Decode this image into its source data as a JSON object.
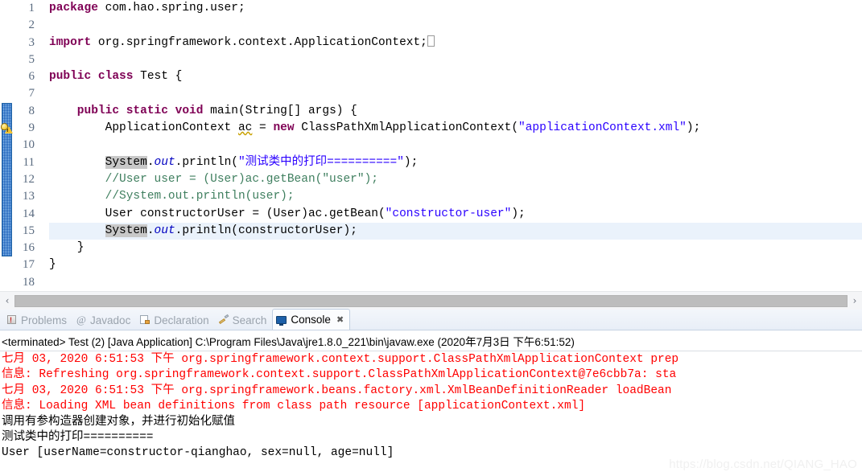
{
  "editor": {
    "lines": [
      {
        "num": "1",
        "fold": "",
        "highlight": false,
        "segments": [
          {
            "t": "package ",
            "c": "kw"
          },
          {
            "t": "com.hao.spring.user;",
            "c": "plain"
          }
        ]
      },
      {
        "num": "2",
        "fold": "",
        "highlight": false,
        "segments": []
      },
      {
        "num": "3",
        "fold": "plus",
        "highlight": false,
        "segments": [
          {
            "t": "import ",
            "c": "kw"
          },
          {
            "t": "org.springframework.context.ApplicationContext;",
            "c": "plain"
          },
          {
            "t": "​",
            "c": "caret"
          }
        ]
      },
      {
        "num": "5",
        "fold": "",
        "highlight": false,
        "segments": []
      },
      {
        "num": "6",
        "fold": "",
        "highlight": false,
        "segments": [
          {
            "t": "public class ",
            "c": "kw"
          },
          {
            "t": "Test {",
            "c": "plain"
          }
        ]
      },
      {
        "num": "7",
        "fold": "",
        "highlight": false,
        "segments": []
      },
      {
        "num": "8",
        "fold": "minus",
        "highlight": false,
        "segments": [
          {
            "t": "    public static void ",
            "c": "kw"
          },
          {
            "t": "main(String[] args) {",
            "c": "plain"
          }
        ]
      },
      {
        "num": "9",
        "fold": "",
        "highlight": false,
        "segments": [
          {
            "t": "        ApplicationContext ",
            "c": "plain"
          },
          {
            "t": "ac",
            "c": "squiggle"
          },
          {
            "t": " = ",
            "c": "plain"
          },
          {
            "t": "new ",
            "c": "kw"
          },
          {
            "t": "ClassPathXmlApplicationContext(",
            "c": "plain"
          },
          {
            "t": "\"applicationContext.xml\"",
            "c": "str"
          },
          {
            "t": ");",
            "c": "plain"
          }
        ]
      },
      {
        "num": "10",
        "fold": "",
        "highlight": false,
        "segments": []
      },
      {
        "num": "11",
        "fold": "",
        "highlight": false,
        "segments": [
          {
            "t": "        ",
            "c": "plain"
          },
          {
            "t": "System",
            "c": "sel"
          },
          {
            "t": ".",
            "c": "plain"
          },
          {
            "t": "out",
            "c": "fld"
          },
          {
            "t": ".println(",
            "c": "plain"
          },
          {
            "t": "\"测试类中的打印==========\"",
            "c": "str"
          },
          {
            "t": ");",
            "c": "plain"
          }
        ]
      },
      {
        "num": "12",
        "fold": "",
        "highlight": false,
        "segments": [
          {
            "t": "        //User user = (User)ac.getBean(\"user\");",
            "c": "cmt"
          }
        ]
      },
      {
        "num": "13",
        "fold": "",
        "highlight": false,
        "segments": [
          {
            "t": "        //System.out.println(user);",
            "c": "cmt"
          }
        ]
      },
      {
        "num": "14",
        "fold": "",
        "highlight": false,
        "segments": [
          {
            "t": "        User constructorUser = (User)ac.getBean(",
            "c": "plain"
          },
          {
            "t": "\"constructor-user\"",
            "c": "str"
          },
          {
            "t": ");",
            "c": "plain"
          }
        ]
      },
      {
        "num": "15",
        "fold": "",
        "highlight": true,
        "segments": [
          {
            "t": "        ",
            "c": "plain"
          },
          {
            "t": "System",
            "c": "sel"
          },
          {
            "t": ".",
            "c": "plain"
          },
          {
            "t": "out",
            "c": "fld"
          },
          {
            "t": ".println(constructorUser);",
            "c": "plain"
          }
        ]
      },
      {
        "num": "16",
        "fold": "",
        "highlight": false,
        "segments": [
          {
            "t": "    }",
            "c": "plain"
          }
        ]
      },
      {
        "num": "17",
        "fold": "",
        "highlight": false,
        "segments": [
          {
            "t": "}",
            "c": "plain"
          }
        ]
      },
      {
        "num": "18",
        "fold": "",
        "highlight": false,
        "segments": []
      }
    ],
    "scroll": {
      "left_arrow": "‹",
      "right_arrow": "›"
    }
  },
  "panel": {
    "tabs": [
      {
        "label": "Problems",
        "icon": "problems-icon",
        "active": false,
        "closable": false
      },
      {
        "label": "Javadoc",
        "icon": "javadoc-icon",
        "active": false,
        "closable": false
      },
      {
        "label": "Declaration",
        "icon": "declaration-icon",
        "active": false,
        "closable": false
      },
      {
        "label": "Search",
        "icon": "search-icon",
        "active": false,
        "closable": false
      },
      {
        "label": "Console",
        "icon": "console-icon",
        "active": true,
        "closable": true
      }
    ],
    "close_glyph": "✖",
    "console_header": "<terminated> Test (2) [Java Application] C:\\Program Files\\Java\\jre1.8.0_221\\bin\\javaw.exe (2020年7月3日 下午6:51:52)",
    "console_lines": [
      {
        "text": "七月 03, 2020 6:51:53 下午 org.springframework.context.support.ClassPathXmlApplicationContext prep",
        "color": "red"
      },
      {
        "text": "信息: Refreshing org.springframework.context.support.ClassPathXmlApplicationContext@7e6cbb7a: sta",
        "color": "red"
      },
      {
        "text": "七月 03, 2020 6:51:53 下午 org.springframework.beans.factory.xml.XmlBeanDefinitionReader loadBean",
        "color": "red"
      },
      {
        "text": "信息: Loading XML bean definitions from class path resource [applicationContext.xml]",
        "color": "red"
      },
      {
        "text": "调用有参构造器创建对象，并进行初始化赋值",
        "color": "black"
      },
      {
        "text": "测试类中的打印==========",
        "color": "black"
      },
      {
        "text": "User [userName=constructor-qianghao, sex=null, age=null]",
        "color": "black"
      }
    ]
  },
  "watermark": {
    "text": "https://blog.csdn.net/QIANG_HAO"
  },
  "colors": {
    "keyword": "#7f0055",
    "string": "#2a00ff",
    "comment": "#3f7f5f",
    "field": "#0000c0",
    "console_error": "#ff0000",
    "highlight_line": "#eaf2fb",
    "selection": "#c8c8c8",
    "marker_blue": "#5b9bd5"
  }
}
